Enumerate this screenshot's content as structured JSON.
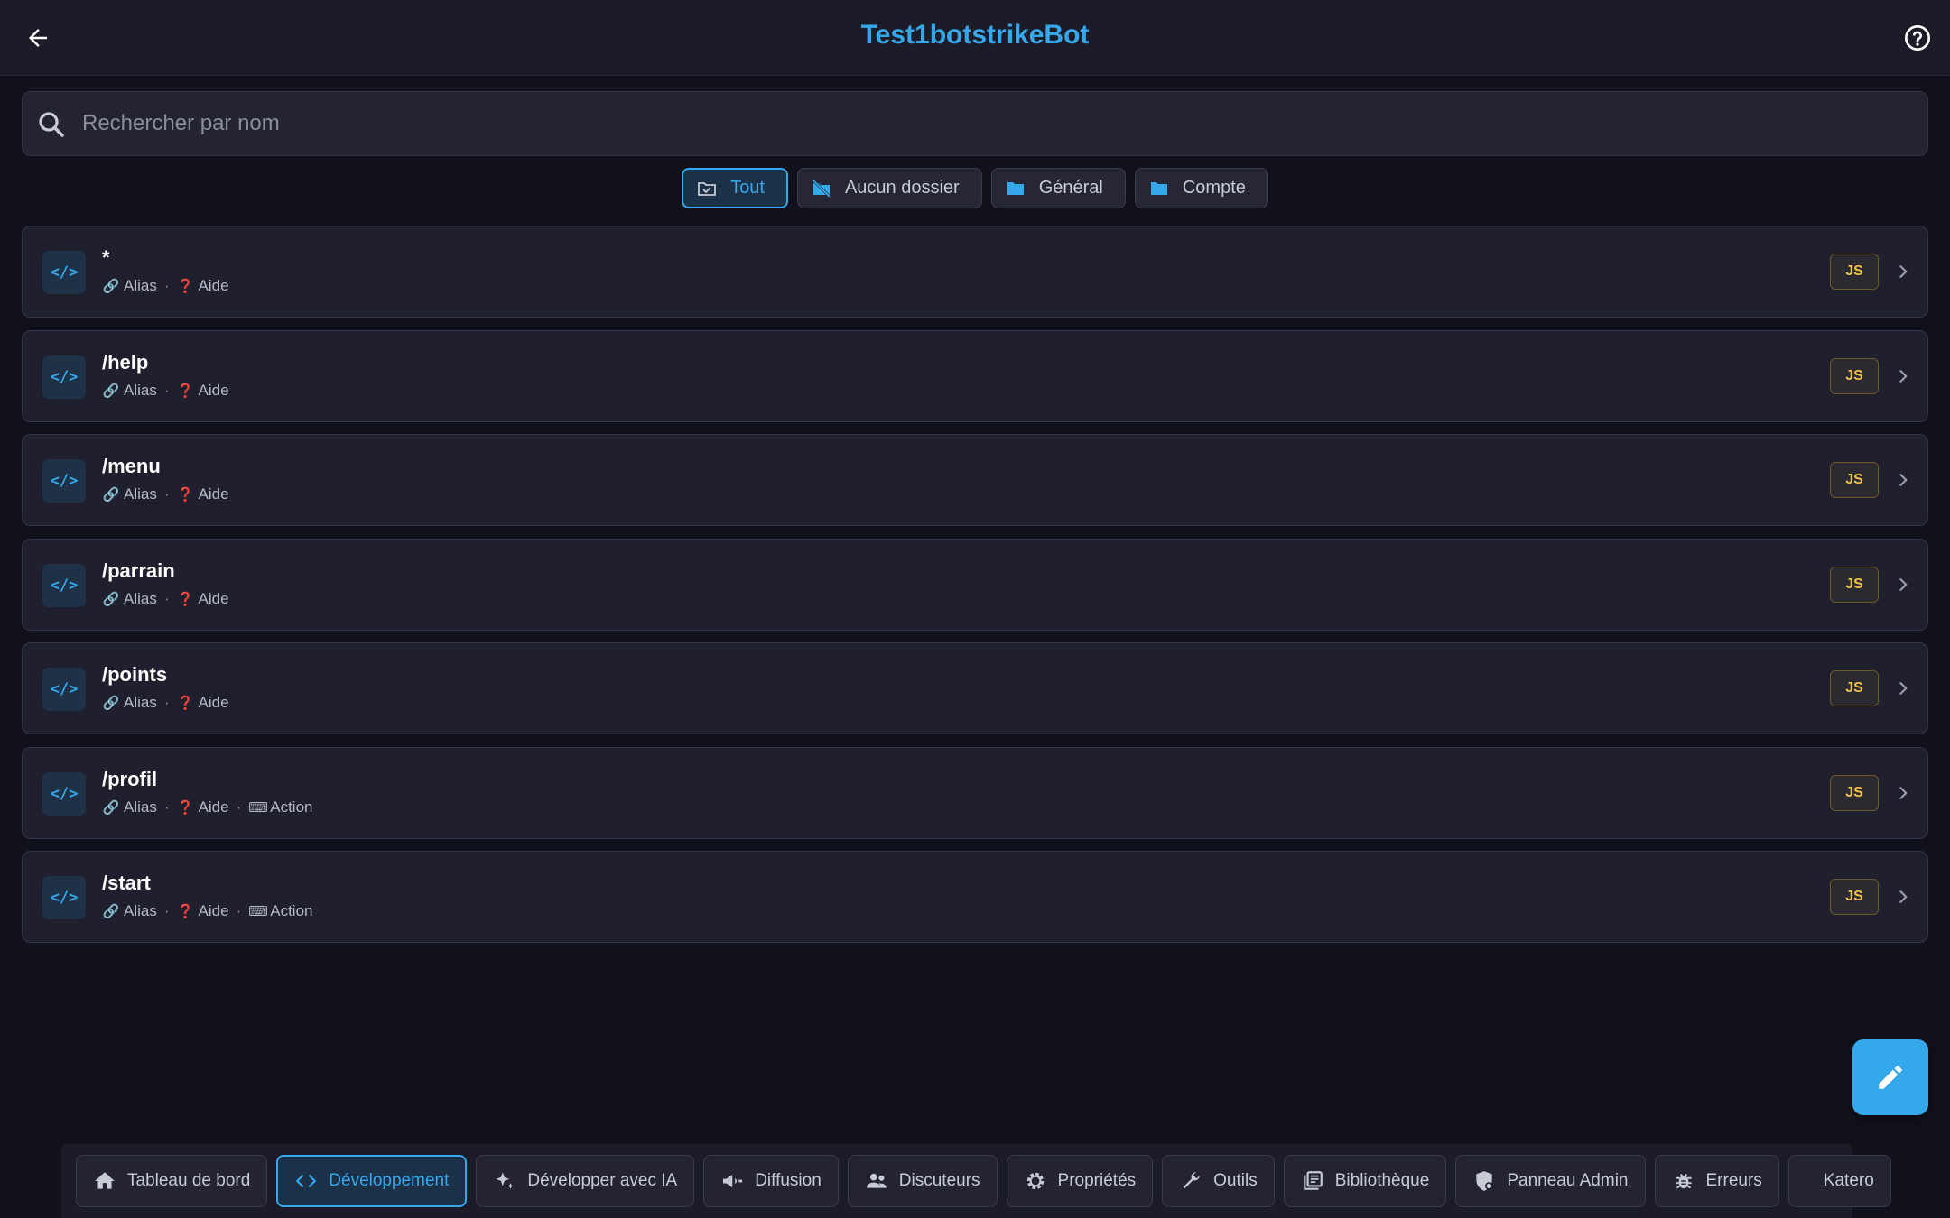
{
  "header": {
    "title": "Test1botstrikeBot",
    "back_icon": "arrow-left-icon",
    "help_icon": "help-circle-icon"
  },
  "search": {
    "placeholder": "Rechercher par nom",
    "value": ""
  },
  "filters": [
    {
      "label": "Tout",
      "icon": "check-folder-icon",
      "active": true
    },
    {
      "label": "Aucun dossier",
      "icon": "folder-off-icon",
      "active": false
    },
    {
      "label": "Général",
      "icon": "folder-icon",
      "active": false
    },
    {
      "label": "Compte",
      "icon": "folder-icon",
      "active": false
    }
  ],
  "commands": [
    {
      "name": "*",
      "alias": "Alias",
      "aide": "Aide",
      "action": "",
      "badge": "JS"
    },
    {
      "name": "/help",
      "alias": "Alias",
      "aide": "Aide",
      "action": "",
      "badge": "JS"
    },
    {
      "name": "/menu",
      "alias": "Alias",
      "aide": "Aide",
      "action": "",
      "badge": "JS"
    },
    {
      "name": "/parrain",
      "alias": "Alias",
      "aide": "Aide",
      "action": "",
      "badge": "JS"
    },
    {
      "name": "/points",
      "alias": "Alias",
      "aide": "Aide",
      "action": "",
      "badge": "JS"
    },
    {
      "name": "/profil",
      "alias": "Alias",
      "aide": "Aide",
      "action": "Action",
      "badge": "JS"
    },
    {
      "name": "/start",
      "alias": "Alias",
      "aide": "Aide",
      "action": "Action",
      "badge": "JS"
    }
  ],
  "code_icon_text": "</>",
  "nav": [
    {
      "label": "Tableau de bord",
      "icon": "home-icon",
      "active": false
    },
    {
      "label": "Développement",
      "icon": "code-icon",
      "active": true
    },
    {
      "label": "Développer avec IA",
      "icon": "sparkle-icon",
      "active": false
    },
    {
      "label": "Diffusion",
      "icon": "megaphone-icon",
      "active": false
    },
    {
      "label": "Discuteurs",
      "icon": "people-icon",
      "active": false
    },
    {
      "label": "Propriétés",
      "icon": "gear-icon",
      "active": false
    },
    {
      "label": "Outils",
      "icon": "wrench-icon",
      "active": false
    },
    {
      "label": "Bibliothèque",
      "icon": "library-icon",
      "active": false
    },
    {
      "label": "Panneau Admin",
      "icon": "admin-shield-icon",
      "active": false
    },
    {
      "label": "Erreurs",
      "icon": "bug-icon",
      "active": false
    },
    {
      "label": "Katero",
      "icon": "",
      "active": false
    }
  ],
  "colors": {
    "accent": "#35a8ec",
    "js_badge": "#f0c24a",
    "background": "#11111c"
  }
}
